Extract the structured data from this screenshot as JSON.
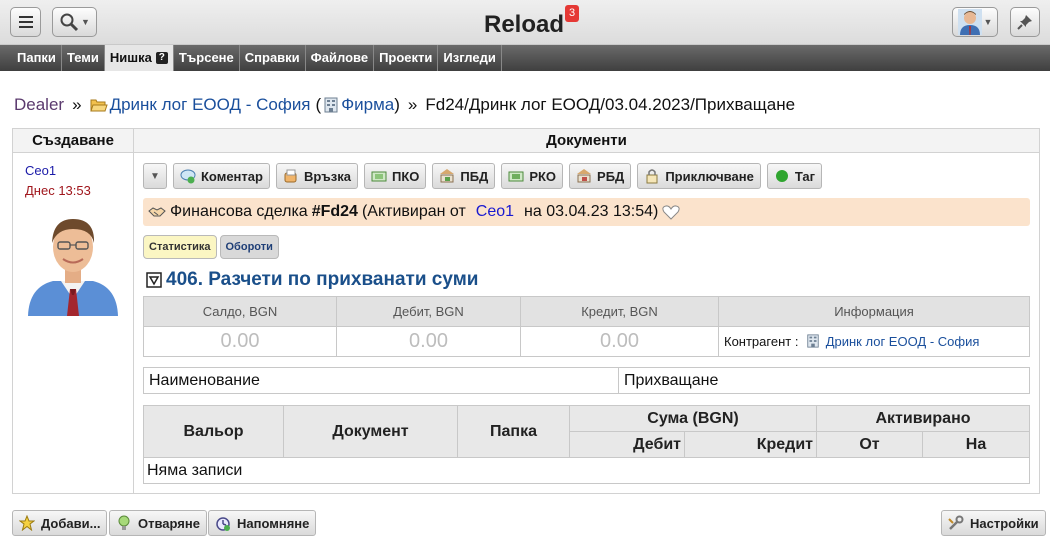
{
  "app": {
    "title": "Reload",
    "notification_count": "3"
  },
  "nav": {
    "items": [
      "Папки",
      "Теми",
      "Нишка",
      "Търсене",
      "Справки",
      "Файлове",
      "Проекти",
      "Изгледи"
    ],
    "help_glyph": "?"
  },
  "breadcrumb": {
    "dealer": "Dealer",
    "separator": "»",
    "company": "Дринк лог ЕООД - София",
    "company_type": "Фирма",
    "path": "Fd24/Дринк лог ЕООД/03.04.2023/Прихващане"
  },
  "columns": {
    "left_header": "Създаване",
    "right_header": "Документи"
  },
  "creator": {
    "name": "Ceo1",
    "time": "Днес 13:53"
  },
  "toolbar": {
    "buttons": [
      {
        "label": "Коментар",
        "icon": "comment-icon"
      },
      {
        "label": "Връзка",
        "icon": "link-icon"
      },
      {
        "label": "ПКО",
        "icon": "cash-in-icon"
      },
      {
        "label": "ПБД",
        "icon": "bank-in-icon"
      },
      {
        "label": "РКО",
        "icon": "cash-out-icon"
      },
      {
        "label": "РБД",
        "icon": "bank-out-icon"
      },
      {
        "label": "Приключване",
        "icon": "lock-icon"
      },
      {
        "label": "Таг",
        "icon": "tag-dot-icon"
      }
    ]
  },
  "deal": {
    "prefix": "Финансова сделка",
    "id": "#Fd24",
    "activated_by_prefix": "(Активиран от",
    "activated_by": "Ceo1",
    "activated_at": "на 03.04.23 13:54)",
    "colors": {
      "background": "#fbe3cc"
    }
  },
  "tabs": {
    "statistics": "Статистика",
    "turnover": "Обороти"
  },
  "section": {
    "title": "406. Разчети по прихванати суми"
  },
  "balance": {
    "headers": [
      "Салдо, BGN",
      "Дебит, BGN",
      "Кредит, BGN",
      "Информация"
    ],
    "values": [
      "0.00",
      "0.00",
      "0.00"
    ],
    "contractor_label": "Контрагент :",
    "contractor": "Дринк лог ЕООД - София"
  },
  "name_row": {
    "label": "Наименование",
    "value": "Прихващане"
  },
  "list": {
    "headers": {
      "valor": "Вальор",
      "document": "Документ",
      "folder": "Папка",
      "sum": "Сума (BGN)",
      "activated": "Активирано"
    },
    "subheaders": {
      "debit": "Дебит",
      "credit": "Кредит",
      "from": "От",
      "to": "На"
    },
    "empty": "Няма записи"
  },
  "footer": {
    "add": "Добави...",
    "reject": "Отваряне",
    "remind": "Напомняне",
    "settings": "Настройки"
  }
}
